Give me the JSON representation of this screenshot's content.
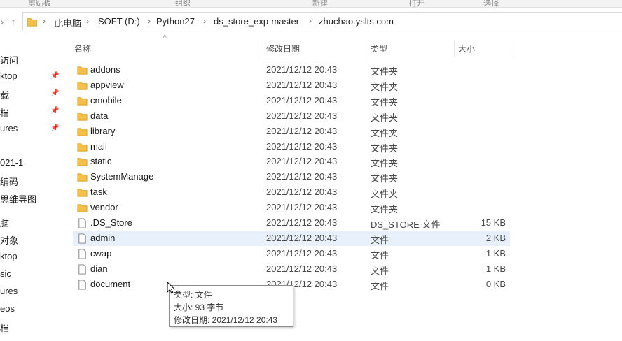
{
  "ribbon": {
    "labels": [
      "剪贴板",
      "组织",
      "新建",
      "打开",
      "选择"
    ]
  },
  "nav": {
    "up_glyph": "↑",
    "prev_glyph": "›"
  },
  "breadcrumb": {
    "root_glyph": "›",
    "items": [
      "此电脑",
      "SOFT (D:)",
      "Python27",
      "ds_store_exp-master",
      "zhuchao.yslts.com"
    ]
  },
  "sidebar": {
    "items": [
      {
        "label": "访问",
        "pinned": false
      },
      {
        "label": "ktop",
        "pinned": true
      },
      {
        "label": "载",
        "pinned": true
      },
      {
        "label": "档",
        "pinned": true
      },
      {
        "label": "ures",
        "pinned": true
      },
      {
        "label": "021-1",
        "pinned": false
      },
      {
        "label": "编码",
        "pinned": false
      },
      {
        "label": "思维导图",
        "pinned": false
      },
      {
        "label": "脑",
        "pinned": false
      },
      {
        "label": "对象",
        "pinned": false
      },
      {
        "label": "ktop",
        "pinned": false
      },
      {
        "label": "sic",
        "pinned": false
      },
      {
        "label": "ures",
        "pinned": false
      },
      {
        "label": "eos",
        "pinned": false
      },
      {
        "label": "档",
        "pinned": false
      }
    ]
  },
  "columns": {
    "name": "名称",
    "date": "修改日期",
    "type": "类型",
    "size": "大小",
    "sort_glyph": "^"
  },
  "files": [
    {
      "name": "addons",
      "date": "2021/12/12 20:43",
      "type": "文件夹",
      "size": "",
      "kind": "folder"
    },
    {
      "name": "appview",
      "date": "2021/12/12 20:43",
      "type": "文件夹",
      "size": "",
      "kind": "folder"
    },
    {
      "name": "cmobile",
      "date": "2021/12/12 20:43",
      "type": "文件夹",
      "size": "",
      "kind": "folder"
    },
    {
      "name": "data",
      "date": "2021/12/12 20:43",
      "type": "文件夹",
      "size": "",
      "kind": "folder"
    },
    {
      "name": "library",
      "date": "2021/12/12 20:43",
      "type": "文件夹",
      "size": "",
      "kind": "folder"
    },
    {
      "name": "mall",
      "date": "2021/12/12 20:43",
      "type": "文件夹",
      "size": "",
      "kind": "folder"
    },
    {
      "name": "static",
      "date": "2021/12/12 20:43",
      "type": "文件夹",
      "size": "",
      "kind": "folder"
    },
    {
      "name": "SystemManage",
      "date": "2021/12/12 20:43",
      "type": "文件夹",
      "size": "",
      "kind": "folder"
    },
    {
      "name": "task",
      "date": "2021/12/12 20:43",
      "type": "文件夹",
      "size": "",
      "kind": "folder"
    },
    {
      "name": "vendor",
      "date": "2021/12/12 20:43",
      "type": "文件夹",
      "size": "",
      "kind": "folder"
    },
    {
      "name": ".DS_Store",
      "date": "2021/12/12 20:43",
      "type": "DS_STORE 文件",
      "size": "15 KB",
      "kind": "file"
    },
    {
      "name": "admin",
      "date": "2021/12/12 20:43",
      "type": "文件",
      "size": "2 KB",
      "kind": "file"
    },
    {
      "name": "cwap",
      "date": "2021/12/12 20:43",
      "type": "文件",
      "size": "1 KB",
      "kind": "file"
    },
    {
      "name": "dian",
      "date": "2021/12/12 20:43",
      "type": "文件",
      "size": "1 KB",
      "kind": "file"
    },
    {
      "name": "document",
      "date": "2021/12/12 20:43",
      "type": "文件",
      "size": "0 KB",
      "kind": "file"
    }
  ],
  "tooltip": {
    "type_line": "类型: 文件",
    "size_line": "大小: 93 字节",
    "date_line": "修改日期: 2021/12/12 20:43"
  },
  "colors": {
    "folder": "#f4c04b",
    "folder_dark": "#d99f1d",
    "highlight": "#e8f1fb",
    "text_secondary": "#4a4a4a"
  }
}
